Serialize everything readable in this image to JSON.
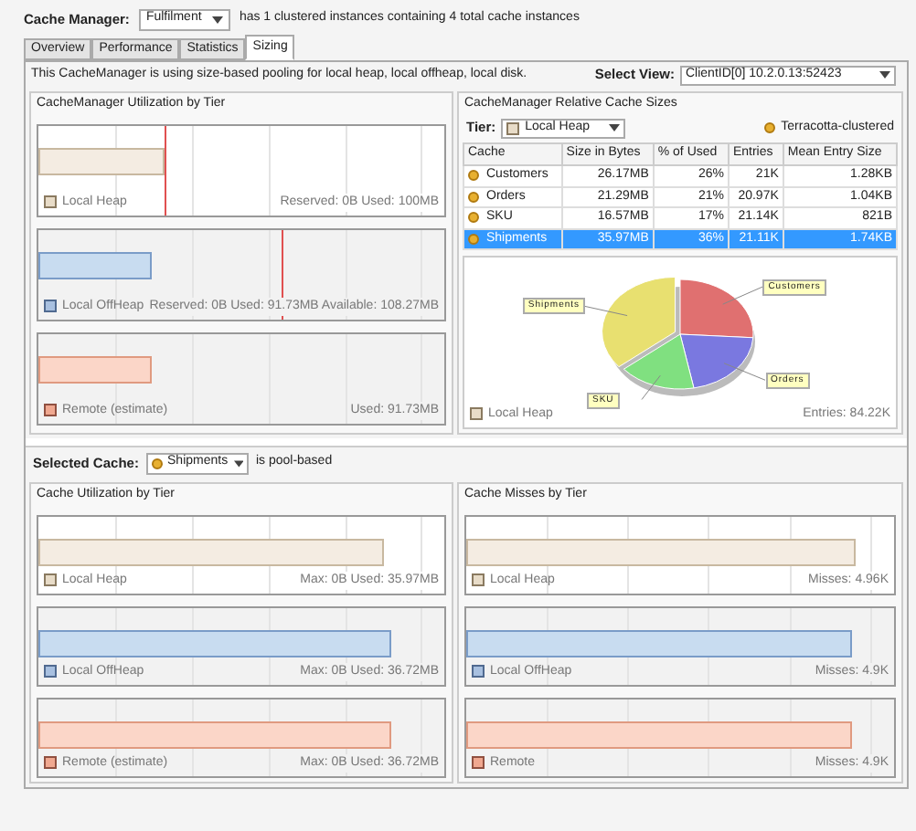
{
  "header": {
    "label": "Cache Manager:",
    "dropdown": "Fulfilment",
    "info": "has 1 clustered instances containing 4 total cache instances"
  },
  "tabs": [
    {
      "label": "Overview",
      "selected": false
    },
    {
      "label": "Performance",
      "selected": false
    },
    {
      "label": "Statistics",
      "selected": false
    },
    {
      "label": "Sizing",
      "selected": true
    }
  ],
  "description": "This CacheManager is using size-based pooling for local heap, local offheap, local disk.",
  "select_view": {
    "label": "Select View:",
    "value": "ClientID[0] 10.2.0.13:52423"
  },
  "utilization": {
    "title": "CacheManager Utilization by Tier",
    "tiers": [
      {
        "kind": "heap",
        "label": "Local Heap",
        "reading": "Reserved: 0B Used: 100MB",
        "level": 0.31,
        "max_marker": {
          "level": 0.31
        }
      },
      {
        "kind": "offheap",
        "label": "Local OffHeap",
        "reading": "Reserved: 0B Used: 91.73MB  Available: 108.27MB",
        "level": 0.28,
        "max_marker": {
          "level": 0.6
        }
      },
      {
        "kind": "remote",
        "label": "Remote (estimate)",
        "reading": "Used: 91.73MB",
        "level": 0.28
      }
    ]
  },
  "relative": {
    "title": "CacheManager Relative Cache Sizes",
    "tier_label": "Tier:",
    "tier_value": "Local Heap",
    "legend": "Terracotta-clustered",
    "columns": [
      "Cache",
      "Size in Bytes",
      "% of Used",
      "Entries",
      "Mean Entry Size"
    ],
    "rows": [
      {
        "cells": [
          "Customers",
          "26.17MB",
          "26%",
          "21K",
          "1.28KB"
        ],
        "selected": false
      },
      {
        "cells": [
          "Orders",
          "21.29MB",
          "21%",
          "20.97K",
          "1.04KB"
        ],
        "selected": false
      },
      {
        "cells": [
          "SKU",
          "16.57MB",
          "17%",
          "21.14K",
          "821B"
        ],
        "selected": false
      },
      {
        "cells": [
          "Shipments",
          "35.97MB",
          "36%",
          "21.11K",
          "1.74KB"
        ],
        "selected": true
      }
    ],
    "pie_labels": [
      "Customers",
      "Orders",
      "SKU",
      "Shipments"
    ],
    "footer_label": "Local Heap",
    "footer_reading": "Entries: 84.22K"
  },
  "selected_cache": {
    "label": "Selected Cache:",
    "value": "Shipments",
    "suffix": "is pool-based"
  },
  "cache_utilization": {
    "title": "Cache Utilization by Tier",
    "tiers": [
      {
        "kind": "heap",
        "label": "Local Heap",
        "reading": "Max: 0B  Used: 35.97MB",
        "level": 0.85
      },
      {
        "kind": "offheap",
        "label": "Local OffHeap",
        "reading": "Max: 0B  Used: 36.72MB",
        "level": 0.87
      },
      {
        "kind": "remote",
        "label": "Remote (estimate)",
        "reading": "Max: 0B  Used: 36.72MB",
        "level": 0.87
      }
    ]
  },
  "cache_misses": {
    "title": "Cache Misses by Tier",
    "tiers": [
      {
        "kind": "heap",
        "label": "Local Heap",
        "reading": "Misses: 4.96K",
        "level": 0.91
      },
      {
        "kind": "offheap",
        "label": "Local OffHeap",
        "reading": "Misses: 4.9K",
        "level": 0.9
      },
      {
        "kind": "remote",
        "label": "Remote",
        "reading": "Misses: 4.9K",
        "level": 0.9
      }
    ]
  }
}
